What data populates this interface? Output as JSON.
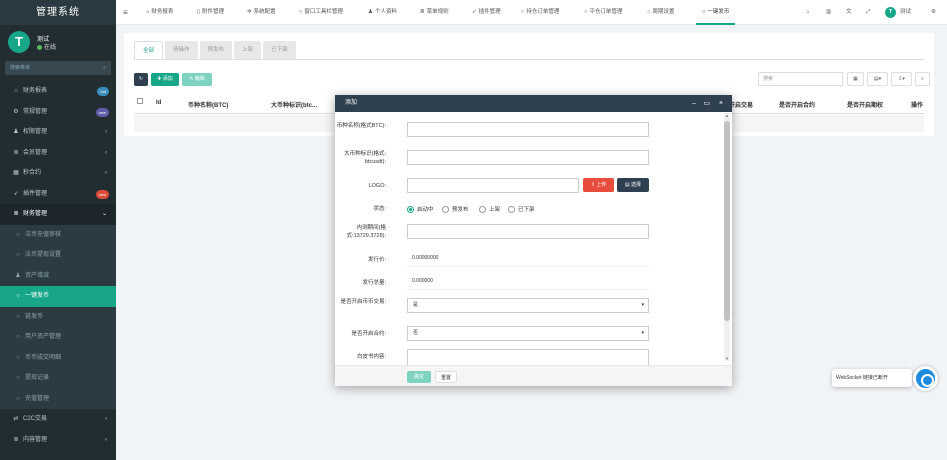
{
  "app": {
    "title": "管理系统"
  },
  "user": {
    "name": "测试",
    "status": "在线",
    "avatar_letter": "T"
  },
  "sidebar": {
    "search_placeholder": "搜索菜单",
    "items": [
      {
        "label": "财务报表",
        "icon": "bank-icon",
        "badge": "hot",
        "badge_color": "#3c8dbc"
      },
      {
        "label": "常规管理",
        "icon": "cog-icon",
        "badge": "new",
        "badge_color": "#605ca8"
      },
      {
        "label": "权限管理",
        "icon": "users-icon",
        "arrow": "‹"
      },
      {
        "label": "会员管理",
        "icon": "list-icon",
        "arrow": "‹"
      },
      {
        "label": "秒合约",
        "icon": "calendar-icon",
        "arrow": "‹"
      },
      {
        "label": "插件管理",
        "icon": "rocket-icon",
        "badge": "new",
        "badge_color": "#dd4b39"
      },
      {
        "label": "财务管理",
        "icon": "list-icon",
        "arrow": "⌄",
        "open": true
      },
      {
        "label": "法币充值审核",
        "sub": true
      },
      {
        "label": "法币提现设置",
        "sub": true
      },
      {
        "label": "资产增减",
        "sub": true,
        "icon": "user-icon"
      },
      {
        "label": "一键发币",
        "sub": true,
        "active": true
      },
      {
        "label": "链发币",
        "sub": true
      },
      {
        "label": "用户资产管理",
        "sub": true
      },
      {
        "label": "币币成交明细",
        "sub": true
      },
      {
        "label": "提现记录",
        "sub": true
      },
      {
        "label": "充值管理",
        "sub": true
      },
      {
        "label": "C2C交易",
        "icon": "exchange-icon",
        "arrow": "‹"
      },
      {
        "label": "内容管理",
        "icon": "list-icon",
        "arrow": "‹"
      }
    ]
  },
  "topnav": {
    "tabs": [
      "财务报表",
      "附件管理",
      "系统配置",
      "窗口工具栏管理",
      "个人资料",
      "菜单规则",
      "插件管理",
      "持仓订单管理",
      "平仓订单管理",
      "周期设置",
      "一键发币"
    ],
    "user_label": "测试"
  },
  "panel": {
    "filter_tabs": [
      "全部",
      "待操作",
      "预发布",
      "上架",
      "已下架"
    ],
    "add_label": "添加",
    "edit_label": "编辑",
    "search_placeholder": "搜索",
    "columns": [
      "Id",
      "币种名称(BTC)",
      "大币种标识(btc...",
      "是否开启交易",
      "是否开启合约",
      "是否开启期权",
      "操作"
    ]
  },
  "modal": {
    "title": "添加",
    "fields": {
      "name_label": "币种名称(格式BTC):",
      "symbol_label": "大币种标识(格式: btcusdt):",
      "logo_label": "LOGO:",
      "upload_label": "上传",
      "select_label": "选择",
      "status_label": "状态:",
      "status_options": [
        "启动中",
        "预发布",
        "上架",
        "已下架"
      ],
      "time_label": "内测期间(格式:13729.3728):",
      "price_label": "发行价:",
      "price_value": "0.00000000",
      "supply_label": "发行总量:",
      "supply_value": "0.000000",
      "trade_label": "是否开启币币交易:",
      "trade_value": "是",
      "contract_label": "是否开启合约:",
      "contract_value": "否",
      "intro_label": "白皮书内容:"
    },
    "ok_label": "确定",
    "reset_label": "重置"
  },
  "toast": {
    "text": "WebSocket 链接已断开"
  },
  "colors": {
    "sidebar_bg": "#222d32",
    "accent": "#18a689",
    "modal_header": "#2f4050",
    "danger": "#e74c3c"
  }
}
